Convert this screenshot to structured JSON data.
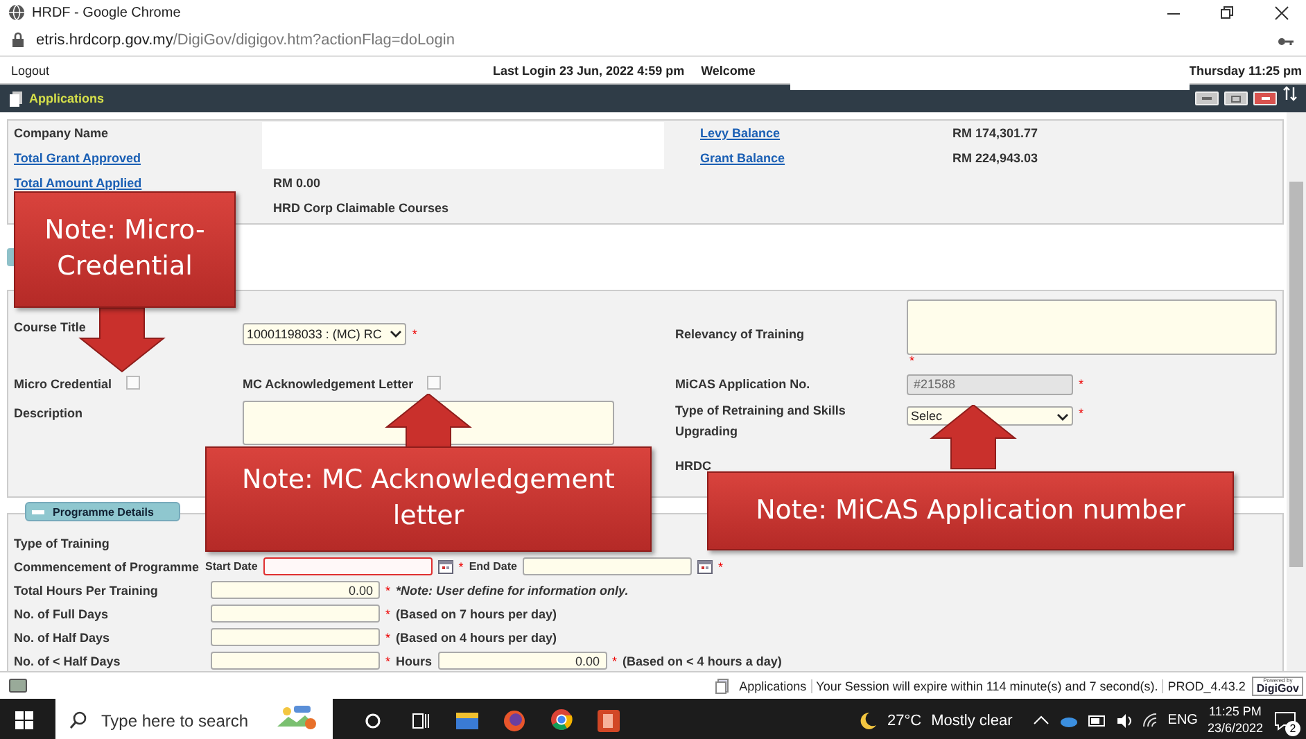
{
  "browser": {
    "title": "HRDF - Google Chrome",
    "url_host": "etris.hrdcorp.gov.my",
    "url_path": "/DigiGov/digigov.htm?actionFlag=doLogin"
  },
  "top_bar": {
    "logout": "Logout",
    "last_login": "Last Login 23 Jun, 2022 4:59 pm",
    "welcome": "Welcome",
    "datetime": "Thursday 11:25 pm"
  },
  "app_bar": {
    "title": "Applications"
  },
  "company": {
    "name_label": "Company Name",
    "grant_approved": "Total Grant Approved",
    "amount_applied": "Total Amount Applied",
    "amount_value": "RM 0.00",
    "course_type": "HRD Corp Claimable Courses",
    "balances": [
      {
        "label": "Levy Balance",
        "value": "RM 174,301.77"
      },
      {
        "label": "Grant Balance",
        "value": "RM 224,943.03"
      }
    ]
  },
  "course": {
    "course_title": {
      "label": "Course Title",
      "value": "10001198033 : (MC) RC",
      "required": "*"
    },
    "relevancy": {
      "label": "Relevancy of Training",
      "required": "*"
    },
    "micro_credential": {
      "label": "Micro Credential",
      "checked": false
    },
    "mc_letter": {
      "label": "MC Acknowledgement Letter",
      "checked": false
    },
    "micas": {
      "label": "MiCAS Application No.",
      "value": "#21588",
      "disabled": true,
      "required": "*"
    },
    "description": {
      "label": "Description"
    },
    "retraining": {
      "label": "Type of Retraining and Skills Upgrading",
      "value": "Selec",
      "required": "*"
    },
    "hrdc": {
      "label": "HRDC"
    }
  },
  "programme": {
    "header": "Programme Details",
    "rows": [
      {
        "kind": "plain",
        "label": "Type of Training"
      },
      {
        "kind": "dates",
        "label": "Commencement of Programme",
        "start_label": "Start Date",
        "start_invalid": true,
        "start_required": "*",
        "end_label": "End Date",
        "end_required": "*"
      },
      {
        "kind": "note",
        "label": "Total Hours Per Training",
        "value": "0.00",
        "required": "*",
        "hint": "*Note: User define for information only."
      },
      {
        "kind": "field",
        "label": "No. of Full Days",
        "required": "*",
        "hint": "(Based on 7 hours per day)"
      },
      {
        "kind": "field",
        "label": "No. of Half Days",
        "required": "*",
        "hint": "(Based on 4 hours per day)"
      },
      {
        "kind": "hours",
        "label": "No. of < Half Days",
        "required": "*",
        "hours_label": "Hours",
        "value": "0.00",
        "hours_required": "*",
        "hint": "(Based on < 4 hours a day)"
      }
    ]
  },
  "status_bar": {
    "module": "Applications",
    "session": "Your Session will expire within 114 minute(s) and 7 second(s).",
    "version": "PROD_4.43.2",
    "logo_caption": "Powered by",
    "logo": "DigiGov"
  },
  "taskbar": {
    "search_placeholder": "Type here to search",
    "temperature": "27°C",
    "weather": "Mostly clear",
    "language": "ENG",
    "time": "11:25 PM",
    "date": "23/6/2022",
    "notifications": "2"
  },
  "callouts": [
    {
      "text": "Note: Micro-Credential",
      "kind": "arrow_down"
    },
    {
      "text": "Note: MC Acknowledgement letter",
      "kind": "arrow_up"
    },
    {
      "text": "Note: MiCAS Application number",
      "kind": "arrow_up"
    }
  ]
}
